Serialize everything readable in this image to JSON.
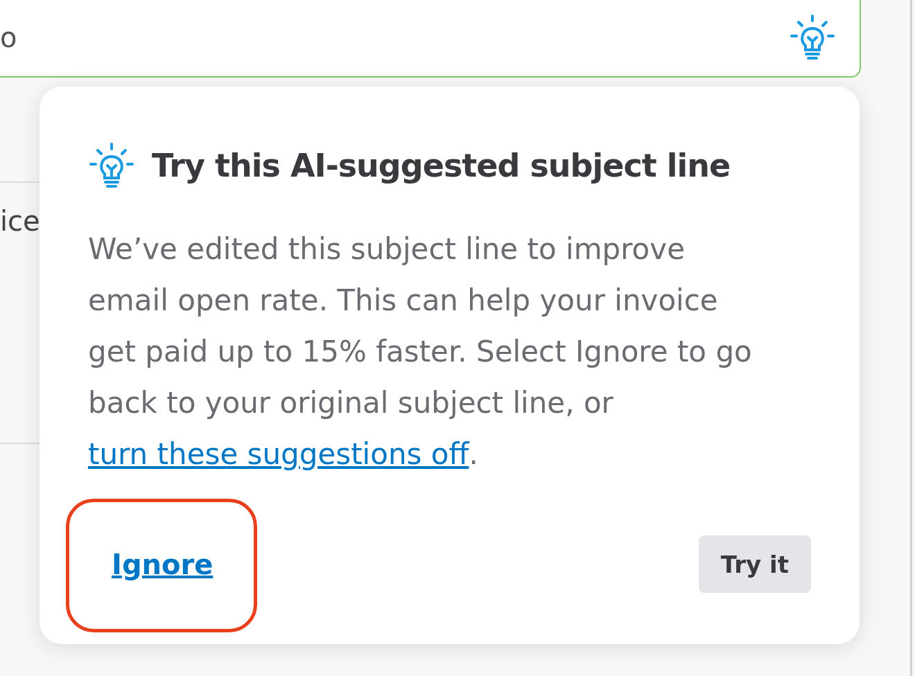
{
  "subject_field": {
    "value": "o"
  },
  "background_label": "ice",
  "popover": {
    "title": "Try this AI-suggested subject line",
    "body": "We’ve edited this subject line to improve email open rate. This can help your invoice get paid up to 15% faster. Select Ignore to go back to your original subject line, or",
    "link": "turn these suggestions off",
    "body_end": ".",
    "buttons": [
      {
        "kind": "link",
        "label": "Ignore"
      },
      {
        "kind": "secondary",
        "label": "Try it"
      }
    ],
    "annotation": {
      "kind": "highlight"
    }
  }
}
